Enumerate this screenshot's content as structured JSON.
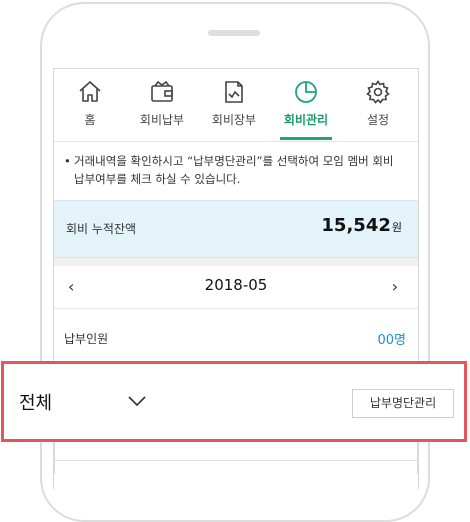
{
  "tabs": [
    {
      "label": "홈",
      "icon": "home-icon",
      "active": false
    },
    {
      "label": "회비납부",
      "icon": "wallet-icon",
      "active": false
    },
    {
      "label": "회비장부",
      "icon": "ledger-icon",
      "active": false
    },
    {
      "label": "회비관리",
      "icon": "pie-chart-icon",
      "active": true
    },
    {
      "label": "설정",
      "icon": "gear-icon",
      "active": false
    }
  ],
  "notice": {
    "bullet": "•",
    "text": "거래내역을 확인하시고 “납부명단관리”를 선택하여 모임 멤버 회비납부여부를 체크 하실 수 있습니다."
  },
  "balance": {
    "label": "회비 누적잔액",
    "amount": "15,542",
    "unit": "원"
  },
  "month": {
    "prev": "‹",
    "value": "2018-05",
    "next": "›"
  },
  "payers": {
    "label": "납부인원",
    "value": "00명"
  },
  "filter": {
    "selected": "전체",
    "button_label": "납부명단관리"
  },
  "colors": {
    "accent": "#1aa67a",
    "highlight_border": "#e5555b",
    "balance_bg": "#e3f3f9",
    "link_blue": "#1b8fd1"
  }
}
